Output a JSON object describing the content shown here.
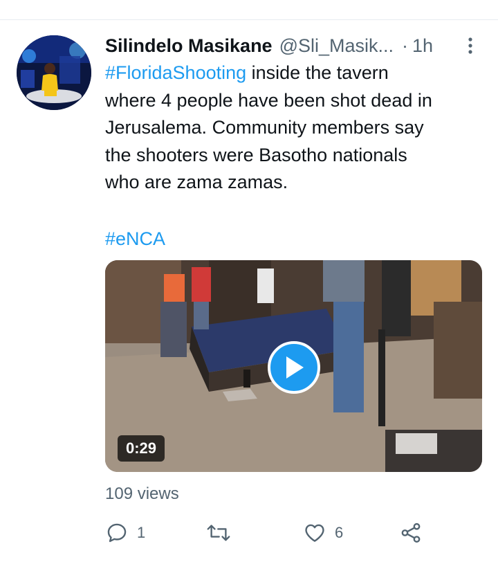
{
  "tweet": {
    "author": {
      "display_name": "Silindelo Masikane",
      "handle": "@Sli_Masik...",
      "separator": "·",
      "time": "1h",
      "avatar": "avatar-photo"
    },
    "text": {
      "hashtag1": "#FloridaShooting",
      "line1_rest": " inside the tavern",
      "line2": "where 4 people have been shot dead in",
      "line3": "Jerusalema. Community members say",
      "line4": "the shooters were Basotho nationals",
      "line5": "who are zama zamas."
    },
    "hashtag2": "#eNCA",
    "media": {
      "type": "video",
      "duration": "0:29",
      "play_icon": "play-icon"
    },
    "views": "109 views",
    "actions": {
      "reply": {
        "icon": "reply-icon",
        "count": "1"
      },
      "retweet": {
        "icon": "retweet-icon",
        "count": ""
      },
      "like": {
        "icon": "heart-icon",
        "count": "6"
      },
      "share": {
        "icon": "share-icon"
      }
    },
    "more_icon": "more-vertical-icon"
  },
  "colors": {
    "link": "#1d9bf0",
    "secondary_text": "#536471",
    "primary_text": "#0f1419",
    "divider": "#e6ecf0",
    "background": "#ffffff"
  }
}
